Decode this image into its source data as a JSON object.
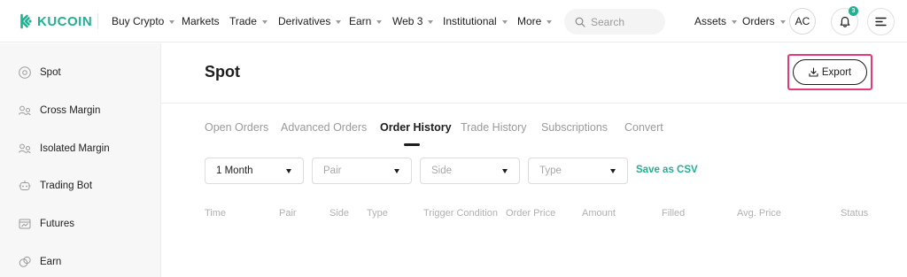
{
  "brand": {
    "name": "KUCOIN",
    "color": "#23af91"
  },
  "nav": {
    "items": [
      {
        "label": "Buy Crypto",
        "dropdown": true
      },
      {
        "label": "Markets",
        "dropdown": false
      },
      {
        "label": "Trade",
        "dropdown": true
      },
      {
        "label": "Derivatives",
        "dropdown": true
      },
      {
        "label": "Earn",
        "dropdown": true
      },
      {
        "label": "Web 3",
        "dropdown": true
      },
      {
        "label": "Institutional",
        "dropdown": true
      },
      {
        "label": "More",
        "dropdown": true
      }
    ],
    "search_placeholder": "Search",
    "assets": {
      "label": "Assets",
      "dropdown": true
    },
    "orders": {
      "label": "Orders",
      "dropdown": true
    },
    "avatar_initials": "AC",
    "notification_count": "3"
  },
  "sidebar": {
    "items": [
      {
        "label": "Spot",
        "icon": "target-icon"
      },
      {
        "label": "Cross Margin",
        "icon": "margin-icon"
      },
      {
        "label": "Isolated Margin",
        "icon": "margin-icon"
      },
      {
        "label": "Trading Bot",
        "icon": "bot-icon"
      },
      {
        "label": "Futures",
        "icon": "futures-icon"
      },
      {
        "label": "Earn",
        "icon": "earn-icon"
      }
    ]
  },
  "main": {
    "title": "Spot",
    "export_label": "Export",
    "highlight_color": "#e5397a",
    "tabs": [
      {
        "label": "Open Orders",
        "active": false
      },
      {
        "label": "Advanced Orders",
        "active": false
      },
      {
        "label": "Order History",
        "active": true
      },
      {
        "label": "Trade History",
        "active": false
      },
      {
        "label": "Subscriptions",
        "active": false
      },
      {
        "label": "Convert",
        "active": false
      }
    ],
    "filters": {
      "period": "1 Month",
      "pair_placeholder": "Pair",
      "side_placeholder": "Side",
      "type_placeholder": "Type"
    },
    "save_csv_label": "Save as CSV",
    "columns": [
      "Time",
      "Pair",
      "Side",
      "Type",
      "Trigger Condition",
      "Order Price",
      "Amount",
      "Filled",
      "Avg. Price",
      "Status"
    ]
  }
}
